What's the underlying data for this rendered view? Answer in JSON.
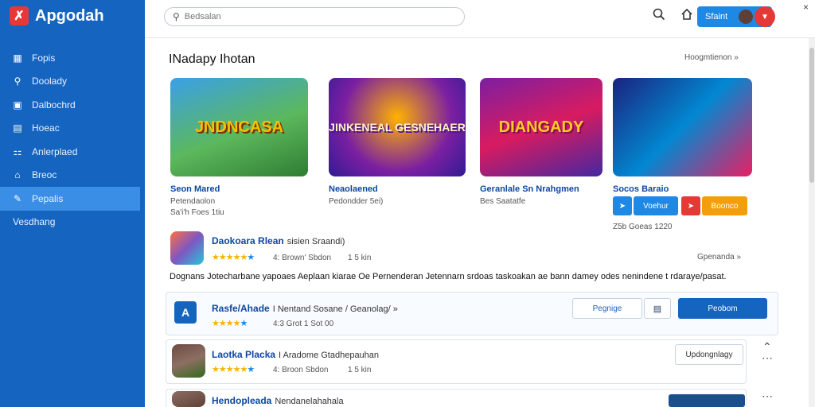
{
  "app": {
    "name": "Apgodah",
    "logo_glyph": "✗"
  },
  "sidebar": {
    "items": [
      {
        "label": "Fopis",
        "icon": "grid-icon",
        "glyph": "▦"
      },
      {
        "label": "Doolady",
        "icon": "search-icon",
        "glyph": "⚲"
      },
      {
        "label": "Dalbochrd",
        "icon": "dashboard-icon",
        "glyph": "▣"
      },
      {
        "label": "Hoeac",
        "icon": "book-icon",
        "glyph": "▤"
      },
      {
        "label": "Anlerplaed",
        "icon": "apps-icon",
        "glyph": "⚏"
      },
      {
        "label": "Breoc",
        "icon": "home-icon",
        "glyph": "⌂"
      },
      {
        "label": "Pepalis",
        "icon": "people-icon",
        "glyph": "✎"
      }
    ],
    "active_index": 6,
    "extra_label": "Vesdhang"
  },
  "topbar": {
    "search_placeholder": "Bedsalan",
    "close_glyph": "×",
    "user_label": "Sfaint",
    "flag_glyph": "▼"
  },
  "featured": {
    "title": "INadapy Ihotan",
    "see_all": "Hoogmtienon »",
    "cards": [
      {
        "art_text": "JNDNCASA",
        "title": "Seon Mared",
        "sub1": "Petendaolon",
        "sub2": "Sa'i'h  Foes 1tiu"
      },
      {
        "art_text": "JINKENEAL GESNEHAER",
        "title": "Neaolaened",
        "sub1": "Pedondder 5ei)",
        "sub2": ""
      },
      {
        "art_text": "DIANGADY",
        "title": "Geranlale Sn Nrahgmen",
        "sub1": "Bes Saatatfe",
        "sub2": ""
      },
      {
        "art_text": "",
        "title": "Socos Baraio",
        "sub1": "",
        "sub2": "Z5b Goeas 1220",
        "btn1": "Voehur",
        "btn2": "Boonco"
      }
    ]
  },
  "list": {
    "rows": [
      {
        "title": "Daokoara Rlean",
        "title_suffix": "sisien Sraandi)",
        "rating_text": "4: Brown' Sbdon",
        "count": "1 5 kin",
        "link": "Gpenanda »"
      },
      {
        "title": "Rasfe/Ahade",
        "title_suffix": "I Nentand Sosane / Geanolag/ »",
        "rating_text": "4:3 Grot 1 Sot 00",
        "count": "",
        "btn_outline": "Pegnige",
        "btn_solid": "Peobom"
      },
      {
        "title": "Laotka Placka",
        "title_suffix": "I Aradome Gtadhepauhan",
        "rating_text": "4: Broon  Sbdon",
        "count": "1 5 kin",
        "btn_outline": "Updongnlagy"
      },
      {
        "title": "Hendopleada",
        "title_suffix": "Nendanelahahala",
        "rating_text": "",
        "count": ""
      }
    ],
    "description": "Dognans Jotecharbane yapoaes Aeplaan kiarae Oe Pernenderan Jetennarn srdoas taskoakan ae bann damey odes nenindene t rdaraye/pasat."
  },
  "colors": {
    "sidebar": "#1565c0",
    "accent": "#1e88e5",
    "danger": "#e53935",
    "orange": "#f59e0b",
    "star": "#f5b400"
  }
}
